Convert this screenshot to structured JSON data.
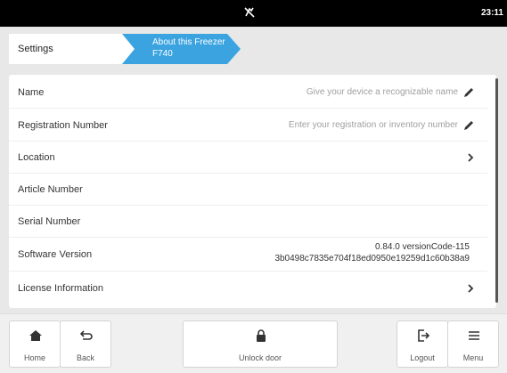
{
  "status_bar": {
    "time": "23:11",
    "mute_icon": "mute-icon"
  },
  "breadcrumb": {
    "items": [
      {
        "label": "Settings"
      },
      {
        "label_line1": "About this Freezer",
        "label_line2": "F740"
      }
    ],
    "active_color": "#3aa3e0"
  },
  "details": {
    "rows": [
      {
        "label": "Name",
        "value": "Give your device a recognizable name",
        "icon": "pencil-icon"
      },
      {
        "label": "Registration Number",
        "value": "Enter your registration or inventory number",
        "icon": "pencil-icon"
      },
      {
        "label": "Location",
        "icon": "chevron-right-icon"
      },
      {
        "label": "Article Number"
      },
      {
        "label": "Serial Number"
      },
      {
        "label": "Software Version",
        "value_line1": "0.84.0 versionCode-115",
        "value_line2": "3b0498c7835e704f18ed0950e19259d1c60b38a9"
      },
      {
        "label": "License Information",
        "icon": "chevron-right-icon"
      }
    ]
  },
  "bottom_bar": {
    "home_label": "Home",
    "back_label": "Back",
    "unlock_label": "Unlock door",
    "logout_label": "Logout",
    "menu_label": "Menu"
  }
}
